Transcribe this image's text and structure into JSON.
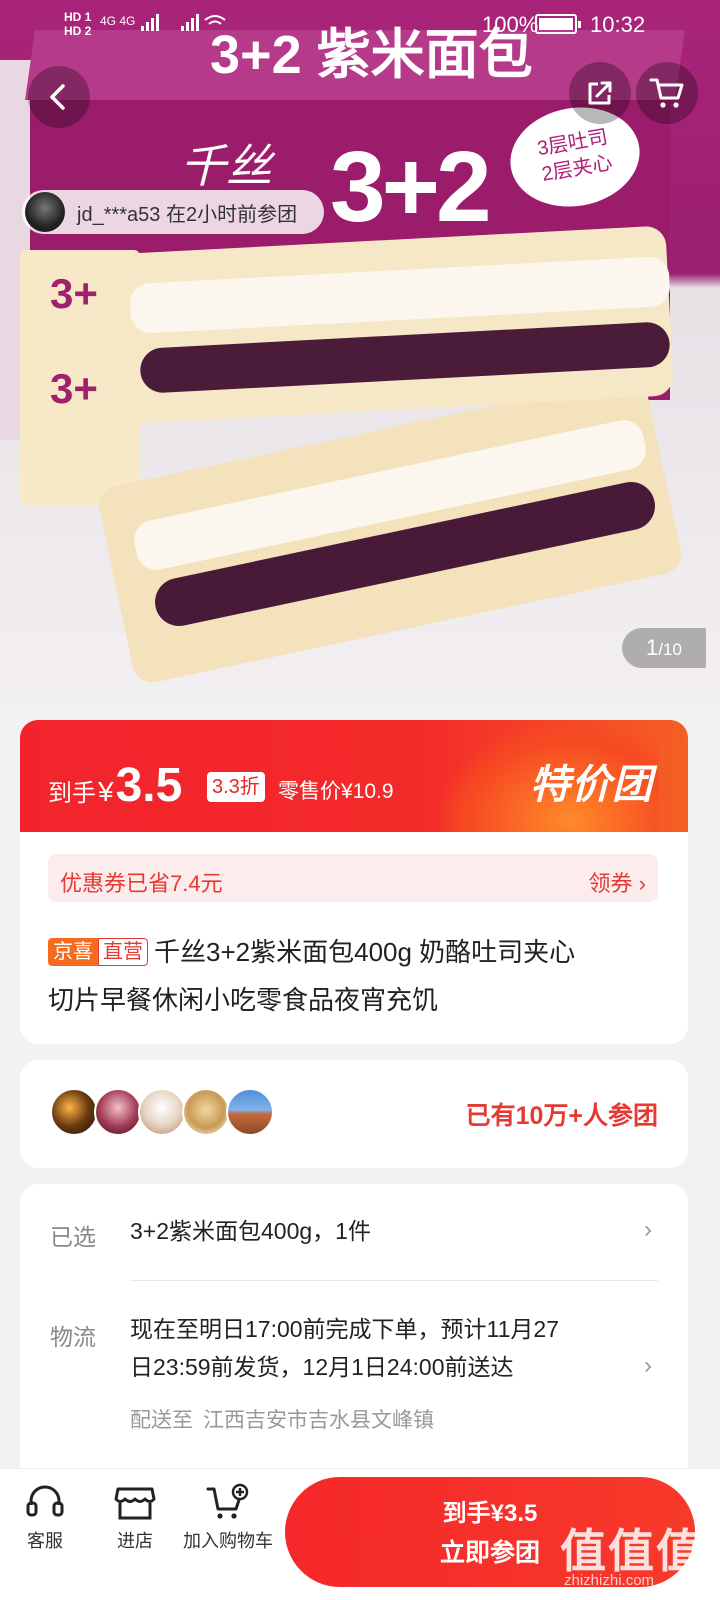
{
  "status_bar": {
    "hd1": "HD 1",
    "hd2": "HD 2",
    "network": "4G 4G",
    "battery": "100%",
    "time": "10:32"
  },
  "hero": {
    "box_top_text": "3+2 紫米面包",
    "logo_text": "千丝",
    "box_big_number": "3+2",
    "bubble_line1": "3层吐司",
    "bubble_line2": "2层夹心",
    "pack_number": "3+",
    "activity_user": "jd_***a53",
    "activity_text": "在2小时前参团",
    "page_current": "1",
    "page_total": "/10"
  },
  "price_banner": {
    "label": "到手",
    "yen": "¥",
    "price": "3.5",
    "discount": "3.3折",
    "retail": "零售价¥10.9",
    "tag": "特价团"
  },
  "info": {
    "coupon_text": "优惠券已省7.4元",
    "coupon_action": "领券 ›",
    "tag_jx": "京喜",
    "tag_zy": "直营",
    "title_line1": "千丝3+2紫米面包400g 奶酪吐司夹心",
    "title_line2": "切片早餐休闲小吃零食品夜宵充饥"
  },
  "group": {
    "text": "已有10万+人参团"
  },
  "options": {
    "selected_label": "已选",
    "selected_value": "3+2紫米面包400g，1件",
    "logistics_label": "物流",
    "logistics_line1": "现在至明日17:00前完成下单，预计11月27",
    "logistics_line2": "日23:59前发货，12月1日24:00前送达",
    "ship_to_label": "配送至",
    "ship_to_value": "江西吉安市吉水县文峰镇",
    "chevron": "›"
  },
  "bottom_bar": {
    "service_label": "客服",
    "store_label": "进店",
    "cart_label": "加入购物车",
    "buy_price": "到手¥3.5",
    "buy_label": "立即参团"
  },
  "watermark": {
    "text": "值值值",
    "url": "zhizhizhi.com"
  },
  "colors": {
    "accent_red": "#f2232c",
    "coupon_bg": "#fdecec",
    "brand_orange": "#f56c20"
  }
}
